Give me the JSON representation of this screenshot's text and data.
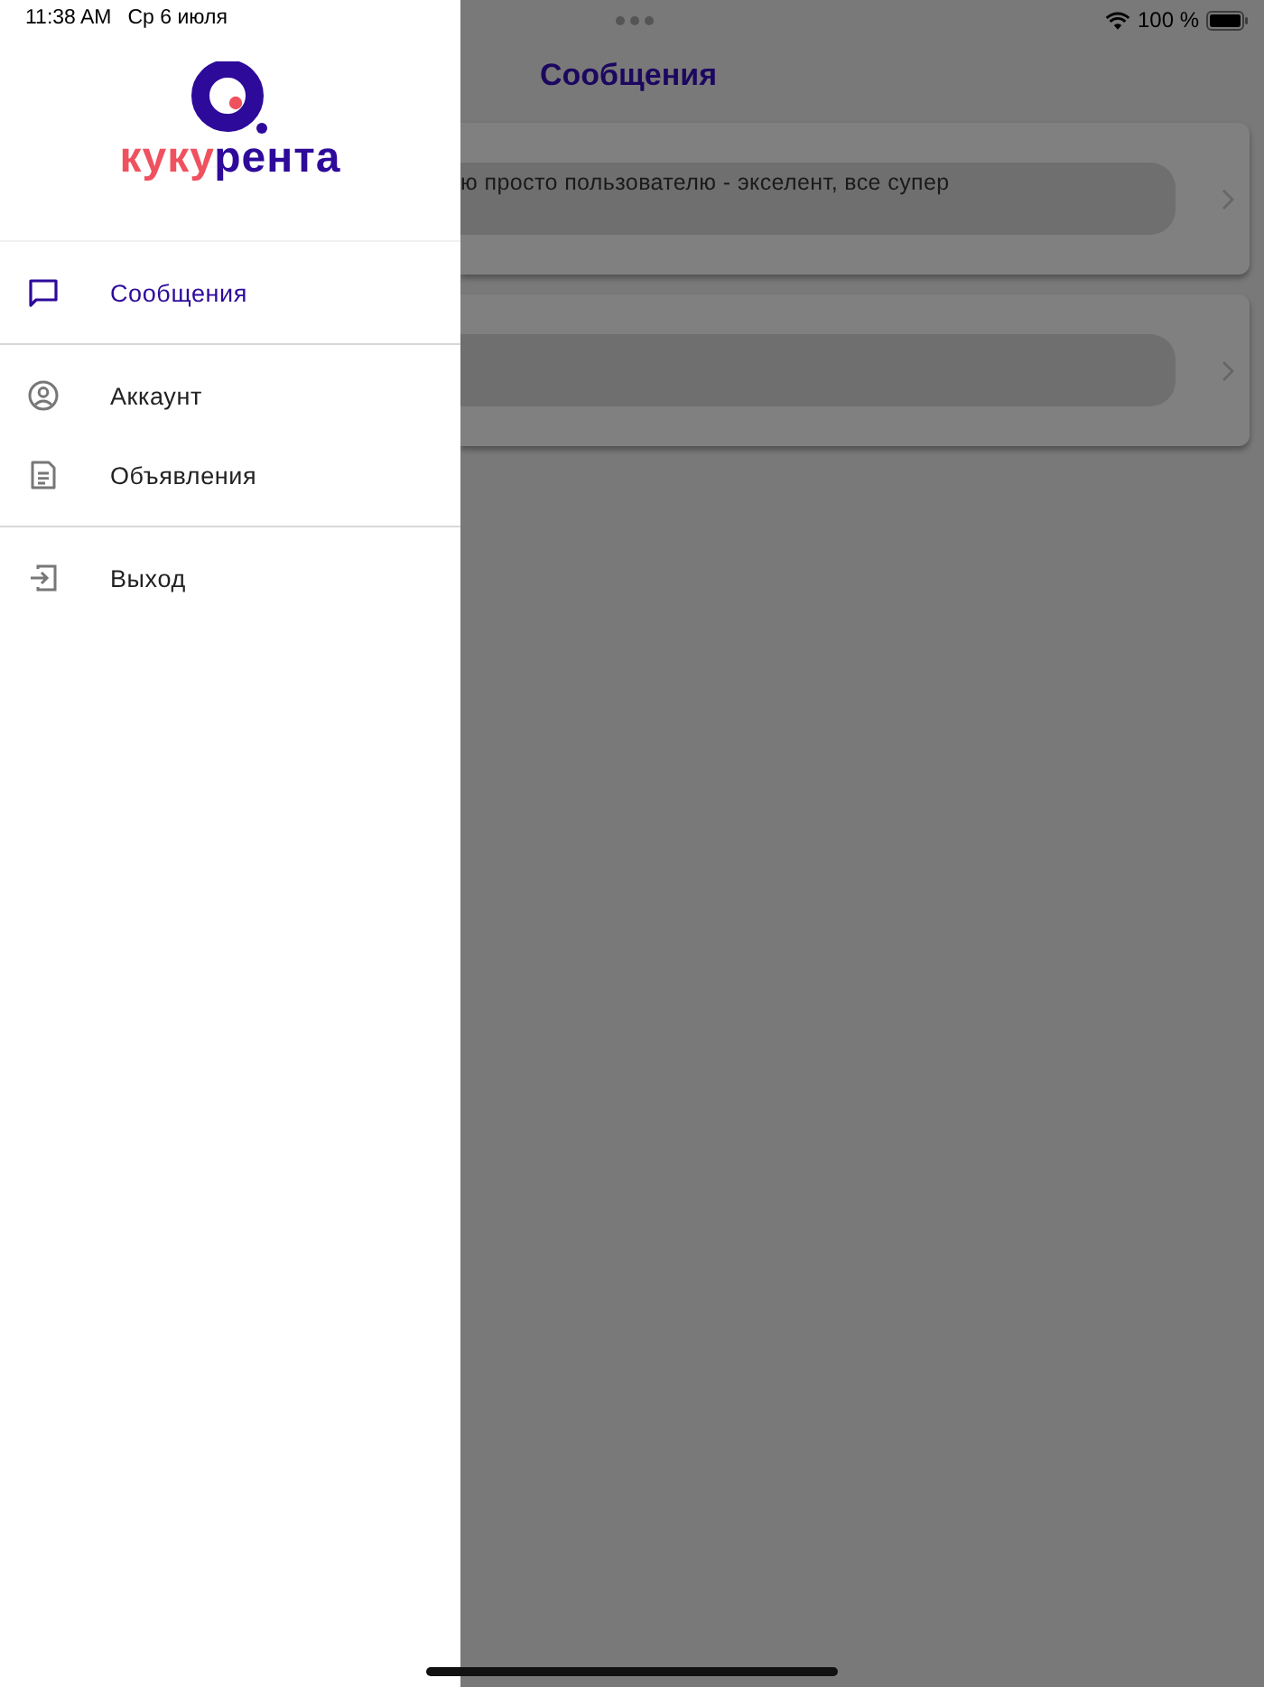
{
  "status_bar": {
    "time": "11:38 AM",
    "date": "Ср 6 июля",
    "battery": "100 %"
  },
  "drawer": {
    "logo": {
      "part_1": "куку",
      "part_2": "рента"
    },
    "groups": [
      [
        {
          "kind": "messages",
          "label": "Сообщения",
          "selected": true
        }
      ],
      [
        {
          "kind": "account",
          "label": "Аккаунт",
          "selected": false
        },
        {
          "kind": "listings",
          "label": "Объявления",
          "selected": false
        }
      ],
      [
        {
          "kind": "logout",
          "label": "Выход",
          "selected": false
        }
      ]
    ]
  },
  "main": {
    "title": "Сообщения",
    "dimmed": true,
    "chats": [
      {
        "kind": "text",
        "message": "ю просто пользователю - экселент, все супер"
      },
      {
        "kind": "empty"
      }
    ]
  }
}
